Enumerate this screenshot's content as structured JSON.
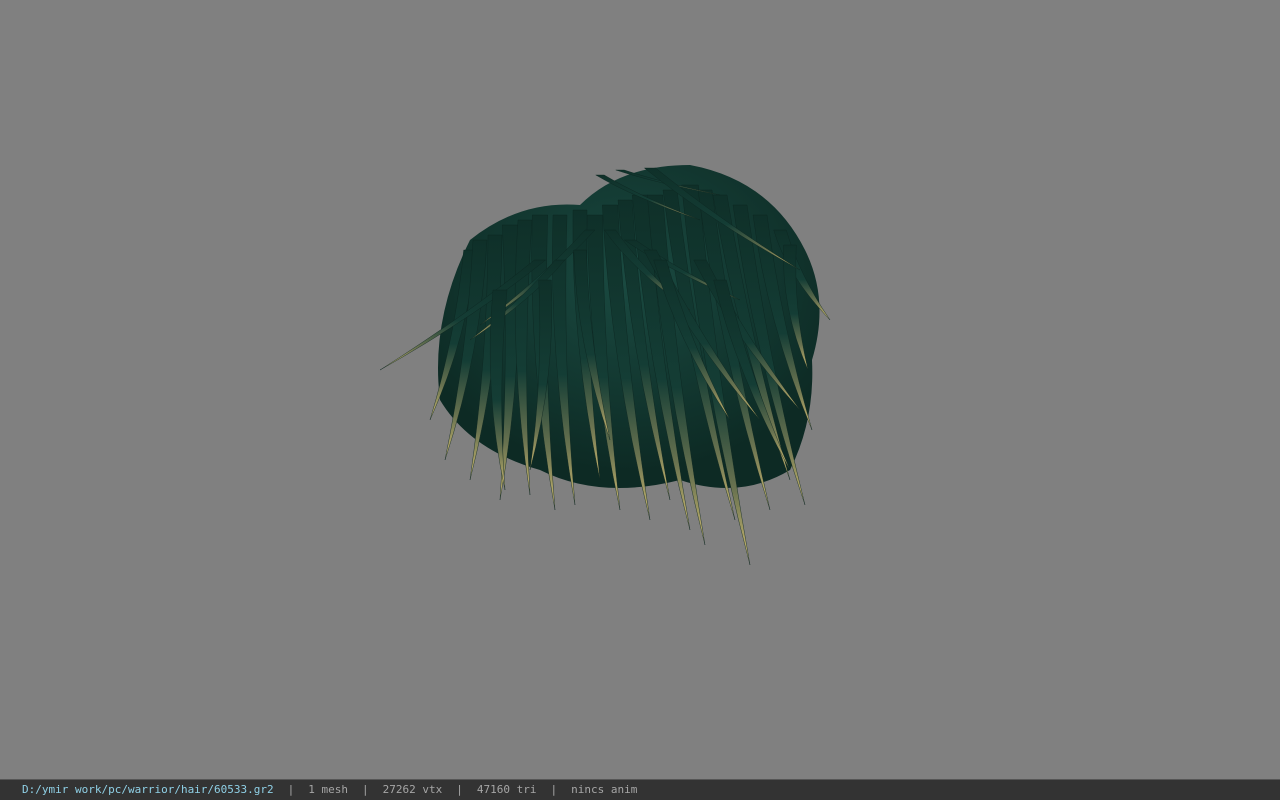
{
  "viewport": {
    "model_name": "hair-mesh",
    "background_color": "#808080",
    "hair_base_color": "#123a32",
    "hair_tip_color": "#c9b46a"
  },
  "status_bar": {
    "file_path": "D:/ymir work/pc/warrior/hair/60533.gr2",
    "mesh_count": "1 mesh",
    "vertex_count": "27262 vtx",
    "triangle_count": "47160 tri",
    "anim_status": "nincs anim",
    "separator": "|"
  }
}
